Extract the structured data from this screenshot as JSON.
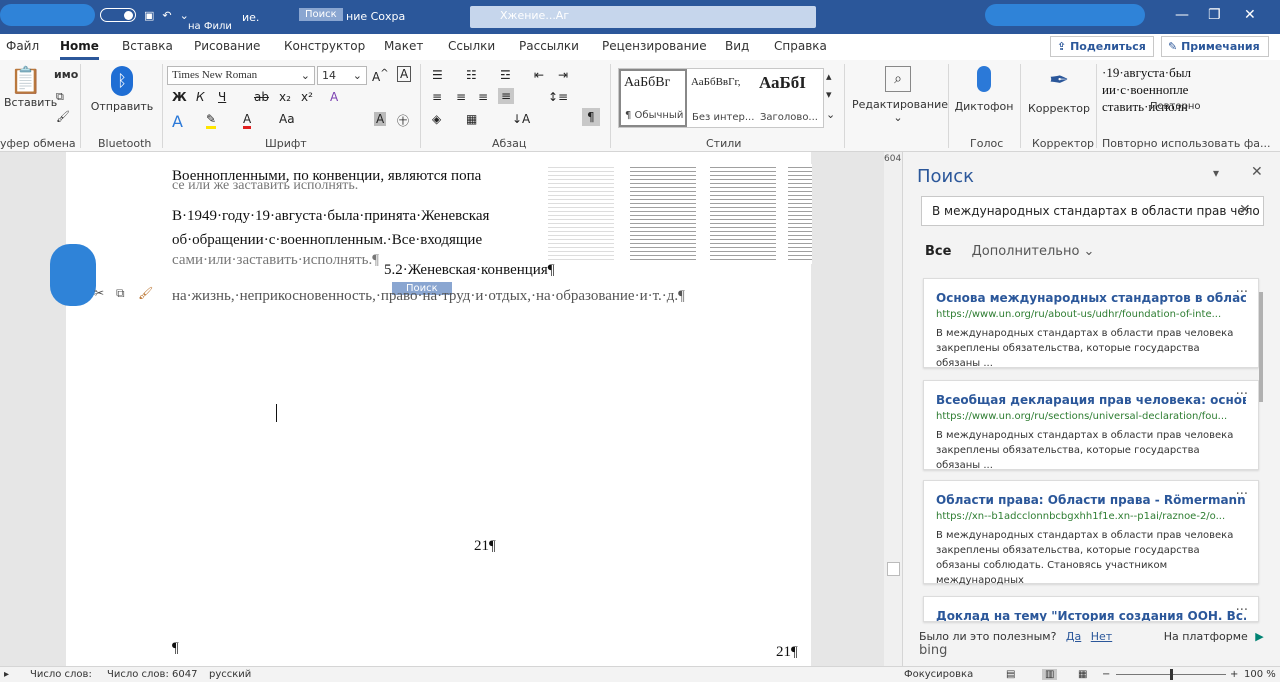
{
  "titlebar": {
    "qa_fragment": "ие.",
    "qa_fragment2": "на Фили",
    "search_tip": "Поиск",
    "title_fragment": "ние Сохра",
    "search_text": "Хжение...Аг",
    "window_controls": [
      "minimize-icon",
      "restore-icon",
      "close-icon"
    ]
  },
  "tabs": [
    "Файл",
    "Home",
    "Вставка",
    "Рисование",
    "Конструктор",
    "Макет",
    "Ссылки",
    "Рассылки",
    "Рецензирование",
    "Вид",
    "Справка"
  ],
  "share_label": "Поделиться",
  "apply_label": "Примечания",
  "ribbon": {
    "paste": "Вставить",
    "clipboard": "уфер обмена",
    "bluetooth_btn": "Отправить",
    "bluetooth_group": "Bluetooth",
    "font_name": "Times New Roman",
    "font_size": "14",
    "font_group": "Шрифт",
    "paragraph_group": "Абзац",
    "styles": [
      {
        "preview": "АаБбВг",
        "name": "¶ Обычный"
      },
      {
        "preview": "АаБбВвГг,",
        "name": "Без интер..."
      },
      {
        "preview": "АаБбI",
        "name": "Заголово..."
      }
    ],
    "styles_group": "Стили",
    "editing": "Редактирование",
    "dictophone": "Диктофон",
    "voice_group": "Голос",
    "corrector": "Корректор",
    "corrector_group": "Корректор",
    "reuse_preview1": "·19·августа·был",
    "reuse_preview2": "ии·с·военнопле",
    "reuse_preview3": "ставить·исполн",
    "reuse_btn": "Повторно",
    "reuse_group": "Повторно использовать фа..."
  },
  "document": {
    "line1": "Военнопленными, по конвенции, являются попа",
    "line1b": "се или же заставить исполнять.",
    "line2": "В·1949·году·19·августа·была·принята·Женевская",
    "line3": "об·обращении·с·военнопленным.·Все·входящие",
    "line4": "сами·или·заставить·исполнять.¶",
    "heading": "5.2·Женевская·конвенция¶",
    "search_tag": "Поиск",
    "line5": "на·жизнь,·неприкосновенность,·право·на·труд·и·отдых,·на·образование·и·т.·д.¶",
    "page_num1": "21¶",
    "page_num2": "21¶",
    "pilcrow": "¶",
    "ruler_num": "604"
  },
  "pane": {
    "title": "Поиск",
    "query": "В международных стандартах в области прав чело",
    "filter_all": "Все",
    "filter_more": "Дополнительно",
    "results": [
      {
        "title": "Основа международных стандартов в облас...",
        "url": "https://www.un.org/ru/about-us/udhr/foundation-of-inte...",
        "desc": "В международных стандартах в области прав человека закреплены обязательства, которые государства обязаны ..."
      },
      {
        "title": "Всеобщая декларация прав человека: основ...",
        "url": "https://www.un.org/ru/sections/universal-declaration/fou...",
        "desc": "В международных стандартах в области прав человека закреплены обязательства, которые государства обязаны ..."
      },
      {
        "title": "Области права: Области права - Römermann...",
        "url": "https://xn--b1adcclonnbcbgxhh1f1e.xn--p1ai/raznoe-2/o...",
        "desc": "В международных стандартах в области прав человека закреплены обязательства, которые государства обязаны соблюдать. Становясь участником международных"
      },
      {
        "title": "Доклад на тему \"История создания ООН. Вс...",
        "url": "",
        "desc": ""
      }
    ],
    "feedback_q": "Было ли это полезным?",
    "yes": "Да",
    "no": "Нет",
    "powered": "На платформе",
    "bing": "bing"
  },
  "status": {
    "words_short": "Число слов:",
    "words": "Число слов: 6047",
    "lang": "русский",
    "focus": "Фокусировка",
    "zoom": "100 %"
  }
}
